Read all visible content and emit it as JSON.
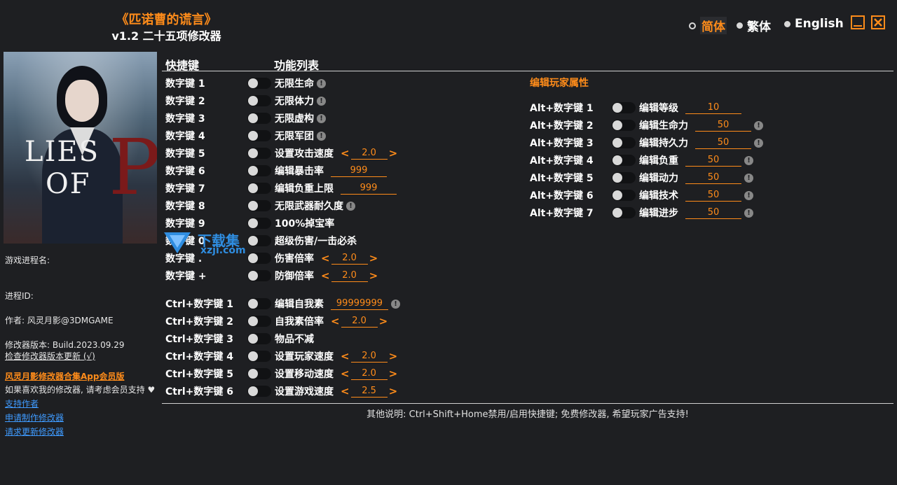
{
  "header": {
    "title": "《匹诺曹的谎言》",
    "subtitle": "v1.2 二十五项修改器",
    "languages": [
      {
        "label": "简体",
        "selected": true
      },
      {
        "label": "繁体",
        "selected": false
      },
      {
        "label": "English",
        "selected": false
      }
    ],
    "minimize_icon": "minimize-icon",
    "close_icon": "close-x-icon",
    "accent_color": "#ff8c1a"
  },
  "sidebar": {
    "cover_logo_line1": "LIES",
    "cover_logo_line2": "OF",
    "cover_logo_p": "P",
    "process_name_label": "游戏进程名:",
    "process_id_label": "进程ID:",
    "author": "作者: 风灵月影@3DMGAME",
    "version": "修改器版本: Build.2023.09.29",
    "check_update": "检查修改器版本更新 (√)",
    "app_promo": "风灵月影修改器合集App会员版",
    "support_text": "如果喜欢我的修改器, 请考虑会员支持 ♥",
    "links": [
      "支持作者",
      "申请制作修改器",
      "请求更新修改器"
    ]
  },
  "watermark": {
    "text": "下载集",
    "url": "xzji.com"
  },
  "main": {
    "hotkey_header": "快捷键",
    "function_header": "功能列表",
    "rows": [
      {
        "hotkey": "数字键 1",
        "label": "无限生命",
        "info": true
      },
      {
        "hotkey": "数字键 2",
        "label": "无限体力",
        "info": true
      },
      {
        "hotkey": "数字键 3",
        "label": "无限虚构",
        "info": true
      },
      {
        "hotkey": "数字键 4",
        "label": "无限军团",
        "info": true
      },
      {
        "hotkey": "数字键 5",
        "label": "设置攻击速度",
        "stepper": "2.0"
      },
      {
        "hotkey": "数字键 6",
        "label": "编辑暴击率",
        "field": "999"
      },
      {
        "hotkey": "数字键 7",
        "label": "编辑负重上限",
        "field": "999"
      },
      {
        "hotkey": "数字键 8",
        "label": "无限武器耐久度",
        "info": true
      },
      {
        "hotkey": "数字键 9",
        "label": "100%掉宝率"
      },
      {
        "hotkey": "数字键 0",
        "label": "超级伤害/一击必杀"
      },
      {
        "hotkey": "数字键 .",
        "label": "伤害倍率",
        "stepper": "2.0"
      },
      {
        "hotkey": "数字键 +",
        "label": "防御倍率",
        "stepper": "2.0"
      },
      {
        "hotkey": "Ctrl+数字键 1",
        "label": "编辑自我素",
        "field": "99999999",
        "info": true
      },
      {
        "hotkey": "Ctrl+数字键 2",
        "label": "自我素倍率",
        "stepper": "2.0"
      },
      {
        "hotkey": "Ctrl+数字键 3",
        "label": "物品不减"
      },
      {
        "hotkey": "Ctrl+数字键 4",
        "label": "设置玩家速度",
        "stepper": "2.0"
      },
      {
        "hotkey": "Ctrl+数字键 5",
        "label": "设置移动速度",
        "stepper": "2.0"
      },
      {
        "hotkey": "Ctrl+数字键 6",
        "label": "设置游戏速度",
        "stepper": "2.5"
      }
    ],
    "right_title": "编辑玩家属性",
    "right_rows": [
      {
        "hotkey": "Alt+数字键 1",
        "label": "编辑等级",
        "field": "10",
        "info": false
      },
      {
        "hotkey": "Alt+数字键 2",
        "label": "编辑生命力",
        "field": "50",
        "info": true
      },
      {
        "hotkey": "Alt+数字键 3",
        "label": "编辑持久力",
        "field": "50",
        "info": true
      },
      {
        "hotkey": "Alt+数字键 4",
        "label": "编辑负重",
        "field": "50",
        "info": true
      },
      {
        "hotkey": "Alt+数字键 5",
        "label": "编辑动力",
        "field": "50",
        "info": true
      },
      {
        "hotkey": "Alt+数字键 6",
        "label": "编辑技术",
        "field": "50",
        "info": true
      },
      {
        "hotkey": "Alt+数字键 7",
        "label": "编辑进步",
        "field": "50",
        "info": true
      }
    ],
    "footer_note": "其他说明: Ctrl+Shift+Home禁用/启用快捷键; 免费修改器, 希望玩家广告支持!"
  }
}
